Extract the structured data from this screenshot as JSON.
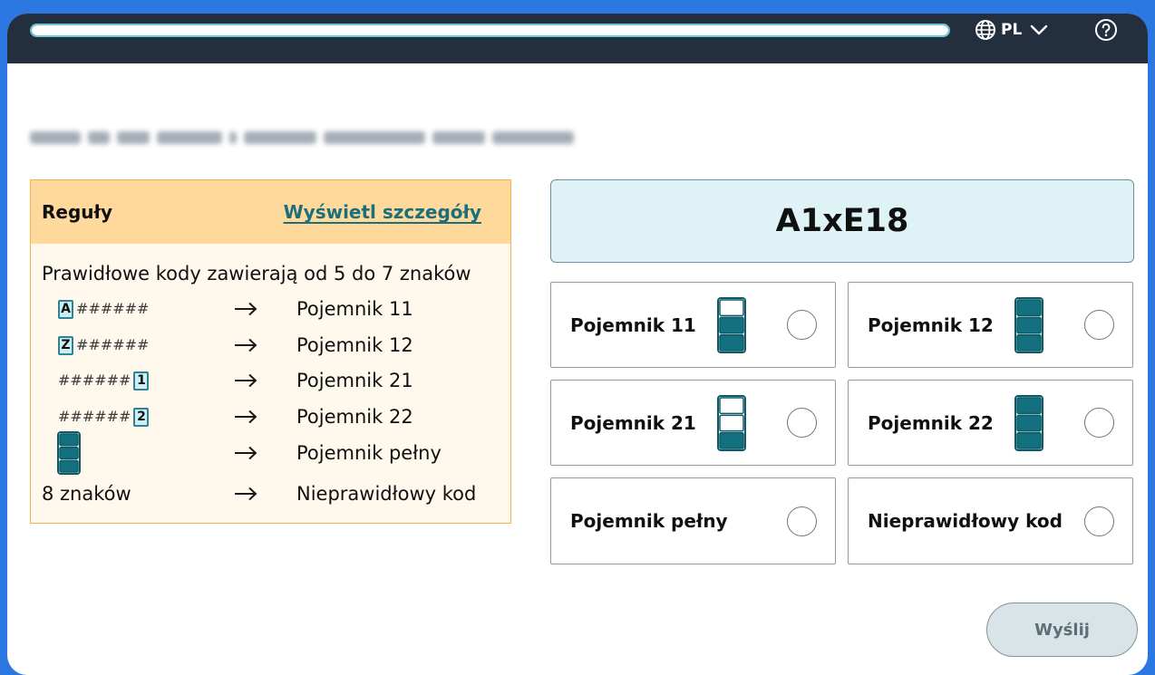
{
  "header": {
    "progress": 1.0,
    "language_icon": "globe-icon",
    "language": "PL",
    "language_dropdown_icon": "chevron-down-icon",
    "help_icon": "help-circle-icon"
  },
  "rules": {
    "title": "Reguły",
    "details_link": "Wyświetl szczegóły",
    "intro": "Prawidłowe kody zawierają od 5 do 7 znaków",
    "arrow_icon": "arrow-right-icon",
    "rows": [
      {
        "prefix": "A",
        "hashes": "######",
        "target": "Pojemnik 11"
      },
      {
        "prefix": "Z",
        "hashes": "######",
        "target": "Pojemnik 12"
      },
      {
        "hashes": "######",
        "suffix": "1",
        "target": "Pojemnik 21"
      },
      {
        "hashes": "######",
        "suffix": "2",
        "target": "Pojemnik 22"
      },
      {
        "icon": "bin-full-icon",
        "filled_slots": 3,
        "total_slots": 3,
        "target": "Pojemnik pełny"
      },
      {
        "text": "8 znaków",
        "target": "Nieprawidłowy kod"
      }
    ]
  },
  "item_code": "A1xE18",
  "options": [
    {
      "label": "Pojemnik 11",
      "icon": "bin-icon",
      "filled_slots": 2,
      "total_slots": 3,
      "selected": false
    },
    {
      "label": "Pojemnik 12",
      "icon": "bin-icon",
      "filled_slots": 3,
      "total_slots": 3,
      "selected": false
    },
    {
      "label": "Pojemnik 21",
      "icon": "bin-icon",
      "filled_slots": 1,
      "total_slots": 3,
      "selected": false
    },
    {
      "label": "Pojemnik 22",
      "icon": "bin-icon",
      "filled_slots": 3,
      "total_slots": 3,
      "selected": false
    },
    {
      "label": "Pojemnik pełny",
      "selected": false
    },
    {
      "label": "Nieprawidłowy kod",
      "selected": false
    }
  ],
  "submit": {
    "label": "Wyślij",
    "enabled": false
  },
  "colors": {
    "page_background": "#2b78e2",
    "topbar_background": "#232f3e",
    "progress_border": "#6fc6d2",
    "rules_border": "#f0b44c",
    "rules_header_background": "#ffd99b",
    "rules_body_background": "#fff8ec",
    "link": "#1b6e7b",
    "char_box_background": "#cdeef4",
    "char_box_border": "#2b8394",
    "code_background": "#dff3f7",
    "code_border": "#6f8d98",
    "option_border": "#8e9ba2",
    "bin_fill": "#13707f",
    "bin_stroke": "#0e5a67",
    "submit_background": "#d9e4e8",
    "submit_border": "#7f949b",
    "submit_text": "#5f6e74"
  }
}
